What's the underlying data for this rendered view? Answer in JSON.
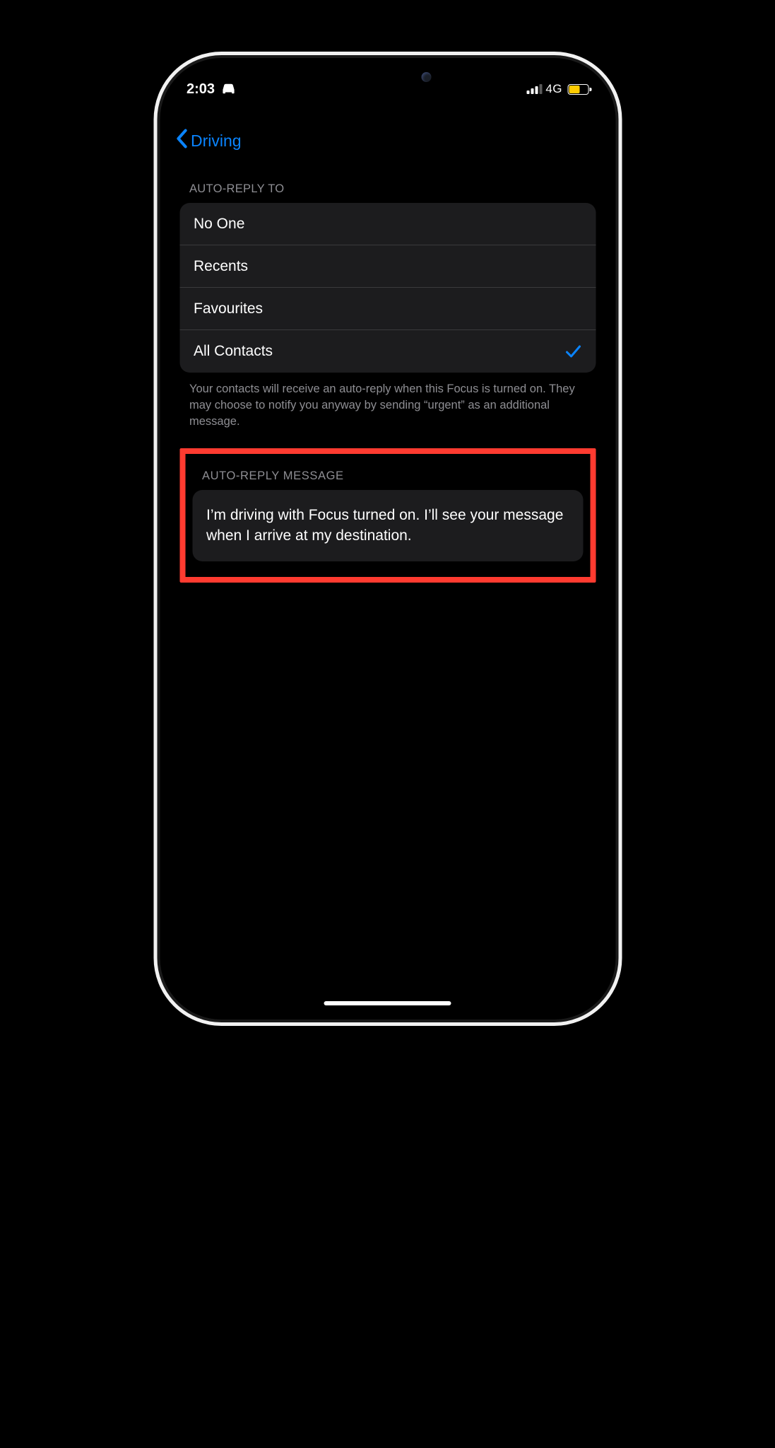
{
  "status_bar": {
    "time": "2:03",
    "network_type": "4G"
  },
  "nav": {
    "back_label": "Driving"
  },
  "auto_reply_to": {
    "header": "AUTO-REPLY TO",
    "options": [
      {
        "label": "No One",
        "selected": false
      },
      {
        "label": "Recents",
        "selected": false
      },
      {
        "label": "Favourites",
        "selected": false
      },
      {
        "label": "All Contacts",
        "selected": true
      }
    ],
    "footer": "Your contacts will receive an auto-reply when this Focus is turned on. They may choose to notify you anyway by sending “urgent” as an additional message."
  },
  "auto_reply_message": {
    "header": "AUTO-REPLY MESSAGE",
    "body": "I’m driving with Focus turned on. I’ll see your message when I arrive at my destination."
  },
  "highlight_color": "#ff3b30",
  "accent_color": "#0a84ff"
}
